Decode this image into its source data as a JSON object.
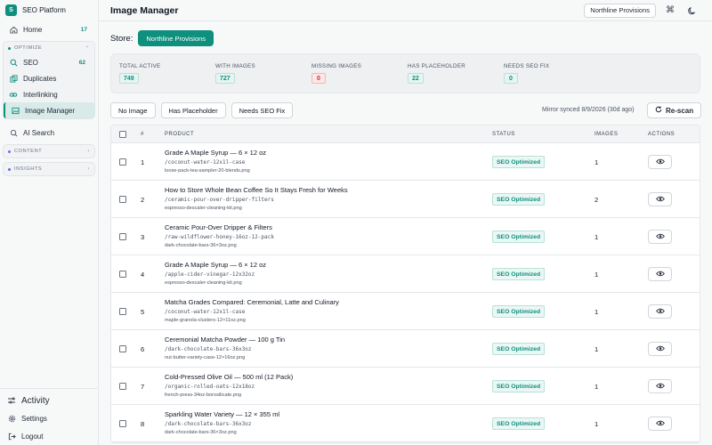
{
  "sidebar": {
    "brand": {
      "logo": "S",
      "name": "SEO Platform"
    },
    "home": {
      "label": "Home",
      "badge": "17",
      "icon": "home-icon"
    },
    "optimize": {
      "label": "OPTIMIZE",
      "items": [
        {
          "label": "SEO",
          "badge": "62",
          "icon": "search-icon"
        },
        {
          "label": "Duplicates",
          "icon": "copy-icon"
        },
        {
          "label": "Interlinking",
          "icon": "link-icon"
        },
        {
          "label": "Image Manager",
          "icon": "image-icon",
          "active": true
        }
      ]
    },
    "ai_search": {
      "label": "AI Search"
    },
    "content": {
      "label": "CONTENT"
    },
    "insights": {
      "label": "INSIGHTS"
    },
    "bottom": {
      "activity": "Activity",
      "settings": "Settings",
      "logout": "Logout"
    }
  },
  "header": {
    "title": "Image Manager",
    "store_selector": "Northline Provisions"
  },
  "store": {
    "label": "Store:",
    "selected": "Northline Provisions"
  },
  "stats": [
    {
      "label": "TOTAL ACTIVE",
      "value": "749",
      "kind": "ok"
    },
    {
      "label": "WITH IMAGES",
      "value": "727",
      "kind": "ok"
    },
    {
      "label": "MISSING IMAGES",
      "value": "0",
      "kind": "bad"
    },
    {
      "label": "HAS PLACEHOLDER",
      "value": "22",
      "kind": "ok"
    },
    {
      "label": "NEEDS SEO FIX",
      "value": "0",
      "kind": "ok"
    }
  ],
  "filters": [
    "No Image",
    "Has Placeholder",
    "Needs SEO Fix"
  ],
  "sync_text": "Mirror synced 8/9/2026 (30d ago)",
  "rescan_label": "Re-scan",
  "table": {
    "headers": {
      "num": "#",
      "product": "PRODUCT",
      "status": "STATUS",
      "images": "IMAGES",
      "actions": "ACTIONS"
    },
    "rows": [
      {
        "num": "1",
        "title": "Grade A Maple Syrup — 6 × 12 oz",
        "handle": "/coconut-water-12x1l-case",
        "file": "loose-pack-tea-sampler-20-blends.png",
        "status": "SEO Optimized",
        "images": "1"
      },
      {
        "num": "2",
        "title": "How to Store Whole Bean Coffee So It Stays Fresh for Weeks",
        "handle": "/ceramic-pour-over-dripper-filters",
        "file": "espresso-descaler-cleaning-kit.png",
        "status": "SEO Optimized",
        "images": "2"
      },
      {
        "num": "3",
        "title": "Ceramic Pour-Over Dripper & Filters",
        "handle": "/raw-wildflower-honey-16oz-12-pack",
        "file": "dark-chocolate-bars-36×3oz.png",
        "status": "SEO Optimized",
        "images": "1"
      },
      {
        "num": "4",
        "title": "Grade A Maple Syrup — 6 × 12 oz",
        "handle": "/apple-cider-vinegar-12x32oz",
        "file": "espresso-descaler-cleaning-kit.png",
        "status": "SEO Optimized",
        "images": "1"
      },
      {
        "num": "5",
        "title": "Matcha Grades Compared: Ceremonial, Latte and Culinary",
        "handle": "/coconut-water-12x1l-case",
        "file": "maple-granola-clusters-12×11oz.png",
        "status": "SEO Optimized",
        "images": "1"
      },
      {
        "num": "6",
        "title": "Ceremonial Matcha Powder — 100 g Tin",
        "handle": "/dark-chocolate-bars-36x3oz",
        "file": "nut-butter-variety-case-12×16oz.png",
        "status": "SEO Optimized",
        "images": "1"
      },
      {
        "num": "7",
        "title": "Cold-Pressed Olive Oil — 500 ml (12 Pack)",
        "handle": "/organic-rolled-oats-12x18oz",
        "file": "french-press-34oz-borosilicate.png",
        "status": "SEO Optimized",
        "images": "1"
      },
      {
        "num": "8",
        "title": "Sparkling Water Variety — 12 × 355 ml",
        "handle": "/dark-chocolate-bars-36x3oz",
        "file": "dark-chocolate-bars-36×3oz.png",
        "status": "SEO Optimized",
        "images": "1"
      }
    ]
  },
  "colors": {
    "accent": "#0f8f7e",
    "danger": "#c53030",
    "active_bg": "#d8ebe8"
  }
}
